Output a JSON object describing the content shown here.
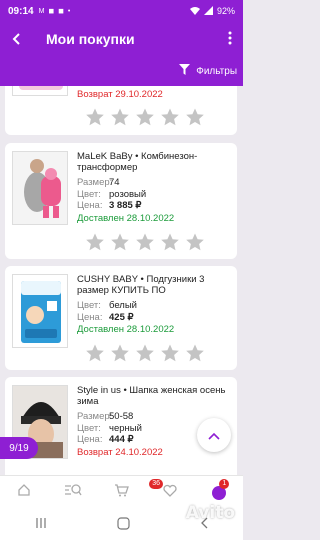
{
  "status_bar": {
    "time": "09:14",
    "status_icons": "M ◼ ◼ •",
    "battery": "92%"
  },
  "appbar": {
    "back_icon": "arrow-left",
    "title": "Мои покупки",
    "more_icon": "vertical-dots"
  },
  "filter": {
    "label": "Фильтры"
  },
  "labels": {
    "size": "Размер:",
    "color": "Цвет:",
    "price": "Цена:"
  },
  "orders": [
    {
      "status": "Возврат 29.10.2022",
      "status_type": "return",
      "rating": 0
    },
    {
      "name": "MaLeK BaBy • Комбинезон-трансформер",
      "size": "74",
      "color": "розовый",
      "price": "3 885 ₽",
      "status": "Доставлен 28.10.2022",
      "status_type": "delivered",
      "rating": 0
    },
    {
      "name": "CUSHY BABY • Подгузники 3 размер КУПИТЬ ПО",
      "color": "белый",
      "price": "425 ₽",
      "status": "Доставлен 28.10.2022",
      "status_type": "delivered",
      "rating": 0
    },
    {
      "name": "Style in us • Шапка женская осень зима",
      "size": "50-58",
      "color": "черный",
      "price": "444 ₽",
      "status": "Возврат 24.10.2022",
      "status_type": "return",
      "rating": 0
    }
  ],
  "pager": {
    "text": "9/19"
  },
  "bottom_nav": {
    "cart_count": "36",
    "profile_count": "1"
  },
  "watermark": "Avito",
  "colors": {
    "brand": "#8e1fd3",
    "delivered": "#1b9b3a",
    "returned": "#e0282a",
    "star": "#c4c4c4"
  }
}
